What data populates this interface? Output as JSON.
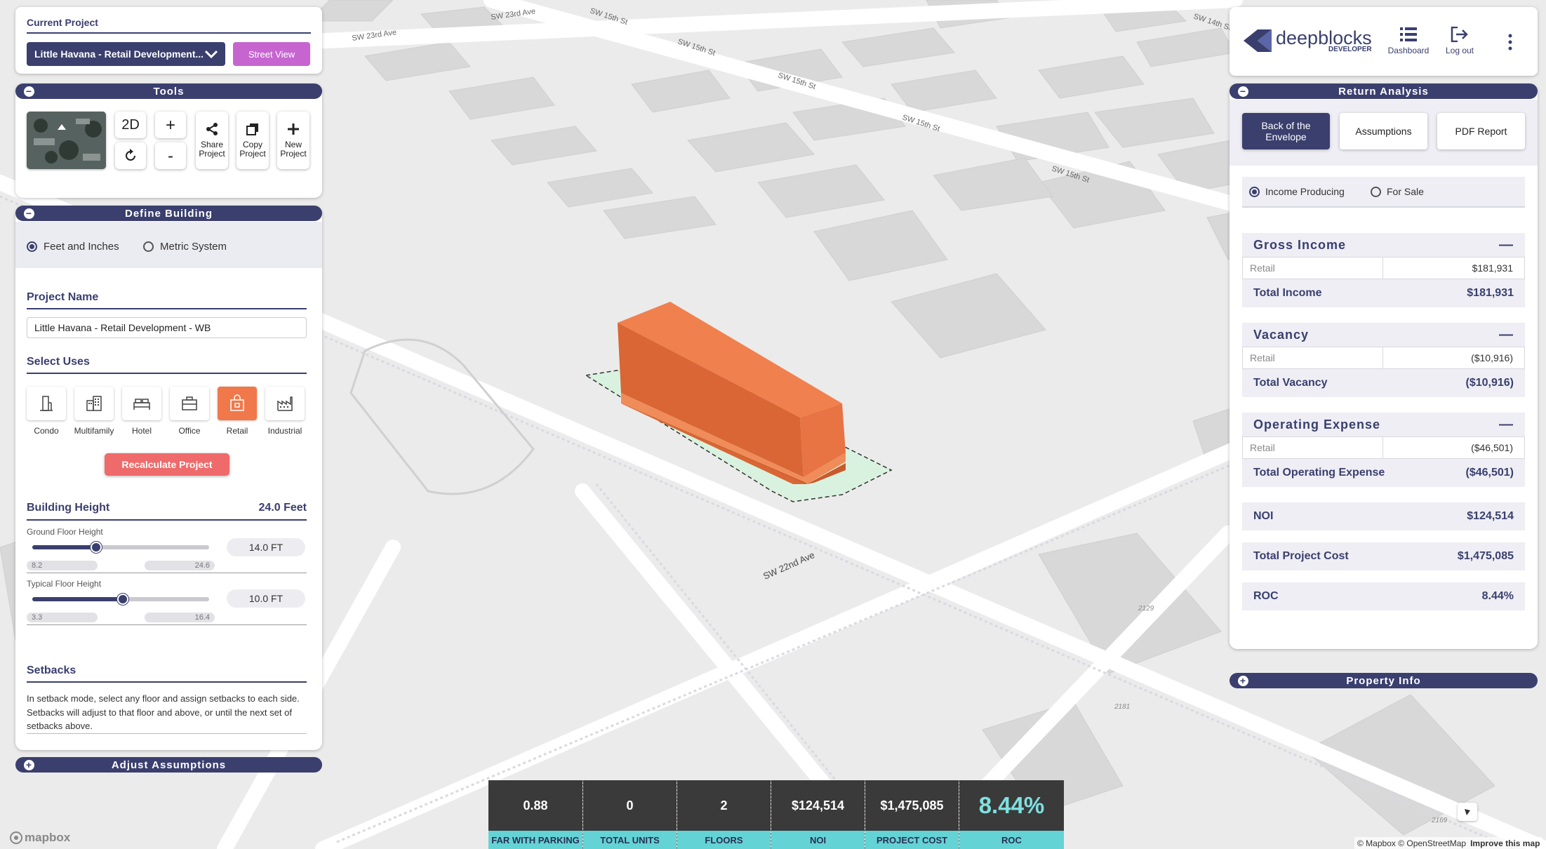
{
  "project": {
    "current_project_label": "Current Project",
    "selected_project": "Little Havana - Retail Development...",
    "street_view_label": "Street View"
  },
  "tools": {
    "title": "Tools",
    "btn_2d": "2D",
    "btn_zoom_in": "+",
    "btn_zoom_out": "-",
    "share": "Share\nProject",
    "copy": "Copy\nProject",
    "new": "New\nProject"
  },
  "define_building": {
    "title": "Define Building",
    "unit_feet": "Feet and Inches",
    "unit_metric": "Metric System",
    "project_name_label": "Project Name",
    "project_name_value": "Little Havana - Retail Development - WB",
    "select_uses_label": "Select Uses",
    "uses": [
      "Condo",
      "Multifamily",
      "Hotel",
      "Office",
      "Retail",
      "Industrial"
    ],
    "active_use": "Retail",
    "recalculate": "Recalculate Project",
    "building_height_label": "Building Height",
    "building_height_value": "24.0 Feet",
    "ground_floor_label": "Ground Floor Height",
    "ground_floor_value": "14.0 FT",
    "ground_floor_min": "8.2",
    "ground_floor_max": "24.6",
    "ground_floor_fraction": 0.36,
    "typical_floor_label": "Typical Floor Height",
    "typical_floor_value": "10.0 FT",
    "typical_floor_min": "3.3",
    "typical_floor_max": "16.4",
    "typical_floor_fraction": 0.51,
    "setbacks_label": "Setbacks",
    "setbacks_text": "In setback mode, select any floor and assign setbacks to each side. Setbacks will adjust to that floor and above, or until the next set of setbacks above."
  },
  "adjust_assumptions": {
    "title": "Adjust Assumptions"
  },
  "header": {
    "logo_text": "deepblocks",
    "logo_sub": "DEVELOPER",
    "dashboard": "Dashboard",
    "logout": "Log out"
  },
  "return_analysis": {
    "title": "Return Analysis",
    "tabs": [
      "Back of the\nEnvelope",
      "Assumptions",
      "PDF Report"
    ],
    "mode_income": "Income Producing",
    "mode_sale": "For Sale",
    "gross_income": {
      "title": "Gross Income",
      "row_label": "Retail",
      "row_value": "$181,931",
      "total_label": "Total Income",
      "total_value": "$181,931"
    },
    "vacancy": {
      "title": "Vacancy",
      "row_label": "Retail",
      "row_value": "($10,916)",
      "total_label": "Total Vacancy",
      "total_value": "($10,916)"
    },
    "operating": {
      "title": "Operating Expense",
      "row_label": "Retail",
      "row_value": "($46,501)",
      "total_label": "Total Operating Expense",
      "total_value": "($46,501)"
    },
    "noi_label": "NOI",
    "noi_value": "$124,514",
    "cost_label": "Total Project Cost",
    "cost_value": "$1,475,085",
    "roc_label": "ROC",
    "roc_value": "8.44%"
  },
  "property_info": {
    "title": "Property Info"
  },
  "metrics": [
    {
      "value": "0.88",
      "label": "FAR WITH PARKING"
    },
    {
      "value": "0",
      "label": "TOTAL UNITS"
    },
    {
      "value": "2",
      "label": "FLOORS"
    },
    {
      "value": "$124,514",
      "label": "NOI"
    },
    {
      "value": "$1,475,085",
      "label": "PROJECT COST"
    },
    {
      "value": "8.44%",
      "label": "ROC"
    }
  ],
  "map": {
    "streets": [
      "SW 23rd Ave",
      "SW 23rd Ave",
      "SW 15th St",
      "SW 15th St",
      "SW 15th St",
      "SW 15th St",
      "SW 15th St",
      "SW 14th St",
      "SW 22nd Ave"
    ],
    "lots": [
      "2129",
      "2181",
      "2169"
    ],
    "attribution": "© Mapbox © OpenStreetMap",
    "improve": "Improve this map",
    "mapbox_logo": "mapbox"
  },
  "colors": {
    "navy": "#3a3f6e",
    "accent_orange": "#f0784a",
    "purple": "#c665d0",
    "teal": "#63d3d5",
    "red": "#ef6a6a"
  }
}
